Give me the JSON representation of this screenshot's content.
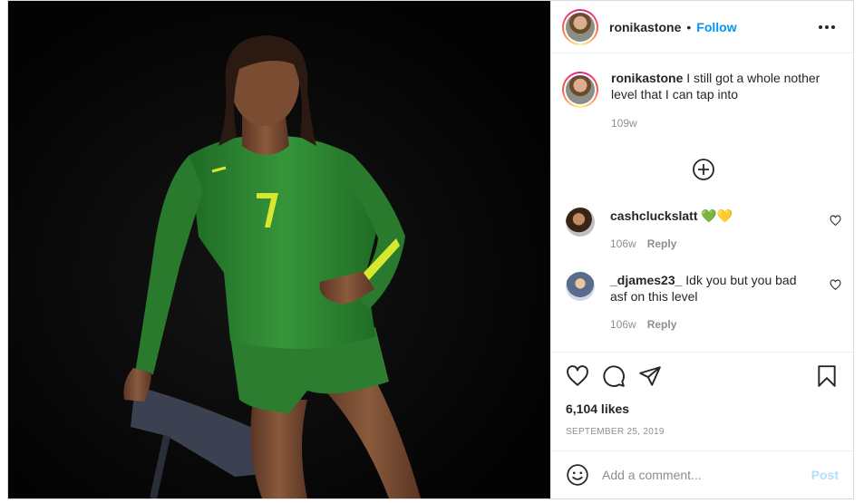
{
  "post": {
    "author": "ronikastone",
    "separator": "•",
    "follow_label": "Follow",
    "photo_icon": "volleyball-player-photo",
    "caption": {
      "username": "ronikastone",
      "text": "I still got a whole nother level that I can tap into",
      "age": "109w"
    },
    "comments": [
      {
        "username": "cashcluckslatt",
        "text": "💚💛",
        "age": "106w",
        "reply_label": "Reply"
      },
      {
        "username": "_djames23_",
        "text": "Idk you but you bad asf on this level",
        "age": "106w",
        "reply_label": "Reply"
      }
    ],
    "likes": "6,104 likes",
    "date": "September 25, 2019",
    "add_comment_placeholder": "Add a comment...",
    "post_button": "Post"
  },
  "colors": {
    "accent": "#0095f6",
    "post_disabled": "#b2dffc",
    "jersey_green": "#2f8a32",
    "jersey_number": "#d8e830"
  }
}
